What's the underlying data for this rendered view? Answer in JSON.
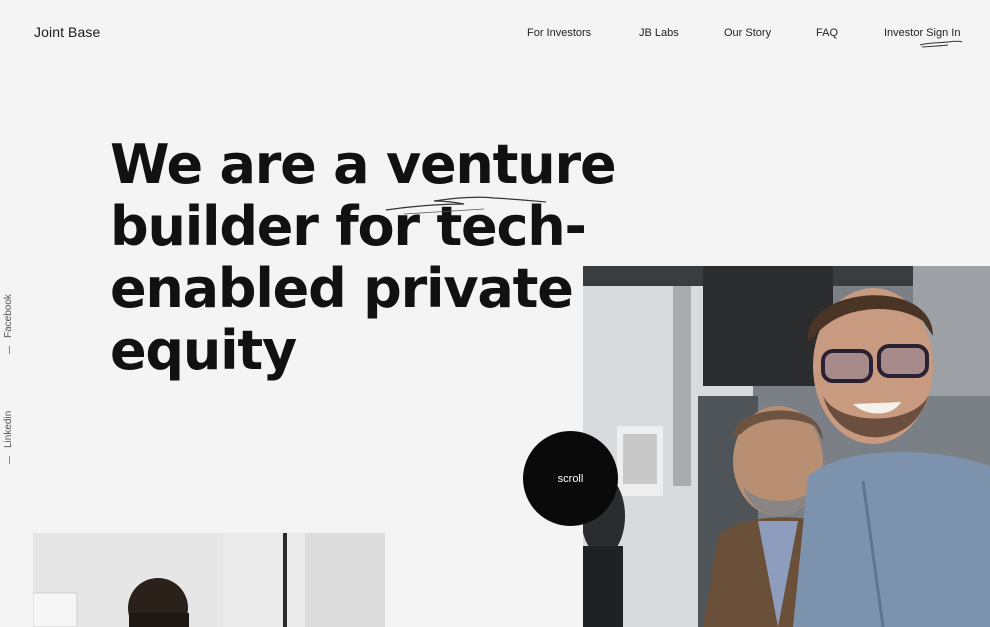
{
  "header": {
    "logo": "Joint Base",
    "nav": [
      "For Investors",
      "JB Labs",
      "Our Story",
      "FAQ",
      "Investor Sign In"
    ]
  },
  "social": {
    "facebook": "Facebook",
    "linkedin": "Linkedin"
  },
  "hero": {
    "lines": [
      "We are a venture",
      "builder for tech-",
      "enabled private",
      "equity"
    ]
  },
  "scroll": {
    "label": "scroll"
  },
  "colors": {
    "background": "#f4f4f4",
    "text": "#111111",
    "scroll_button": "#0a0a0a"
  }
}
